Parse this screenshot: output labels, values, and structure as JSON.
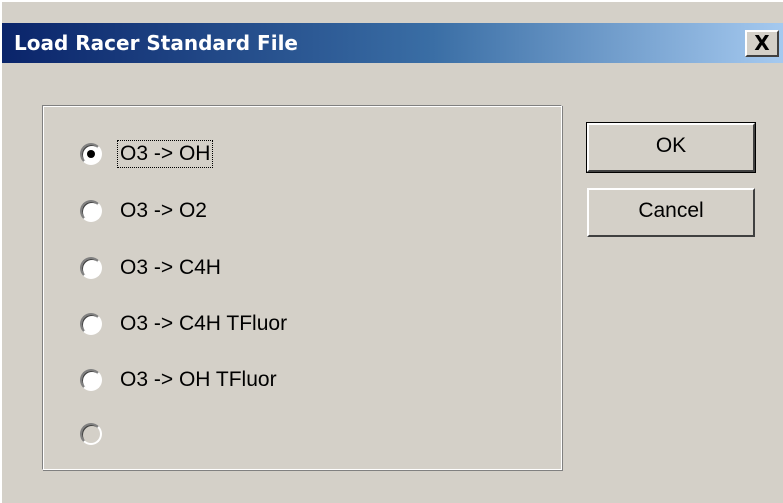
{
  "window": {
    "title": "Load Racer Standard File",
    "close_label": "X"
  },
  "options": [
    {
      "label": "O3 -> OH",
      "selected": true,
      "enabled": true
    },
    {
      "label": "O3 -> O2",
      "selected": false,
      "enabled": true
    },
    {
      "label": "O3 -> C4H",
      "selected": false,
      "enabled": true
    },
    {
      "label": "O3 -> C4H TFluor",
      "selected": false,
      "enabled": true
    },
    {
      "label": "O3 -> OH TFluor",
      "selected": false,
      "enabled": true
    },
    {
      "label": "",
      "selected": false,
      "enabled": false
    }
  ],
  "buttons": {
    "ok": "OK",
    "cancel": "Cancel"
  },
  "colors": {
    "dialog_face": "#d4d0c8",
    "title_start": "#0a246a",
    "title_end": "#a6caf0"
  }
}
